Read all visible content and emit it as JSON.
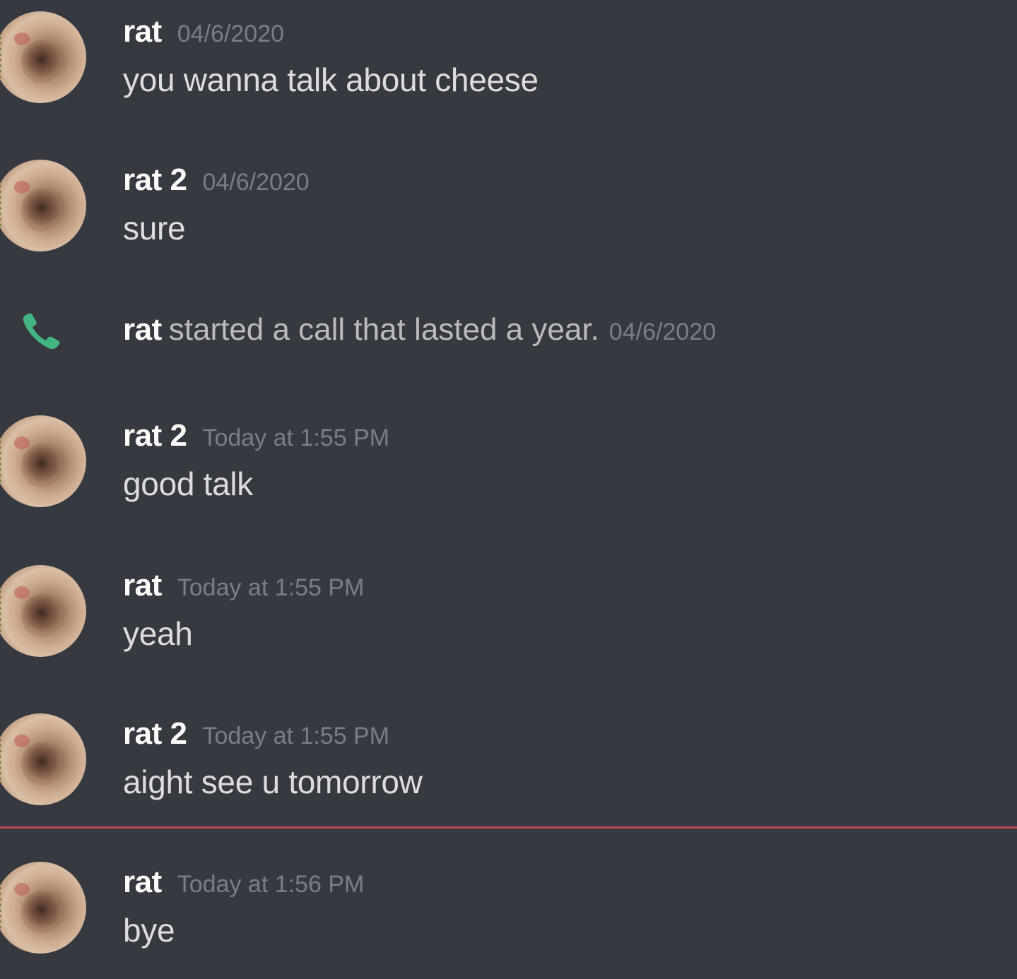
{
  "messages": [
    {
      "username": "rat",
      "timestamp": "04/6/2020",
      "text": "you wanna talk about cheese"
    },
    {
      "username": "rat 2",
      "timestamp": "04/6/2020",
      "text": "sure"
    },
    {
      "username": "rat 2",
      "timestamp": "Today at 1:55 PM",
      "text": "good talk"
    },
    {
      "username": "rat",
      "timestamp": "Today at 1:55 PM",
      "text": "yeah"
    },
    {
      "username": "rat 2",
      "timestamp": "Today at 1:55 PM",
      "text": "aight see u tomorrow"
    },
    {
      "username": "rat",
      "timestamp": "Today at 1:56 PM",
      "text": "bye"
    }
  ],
  "call_event": {
    "username": "rat",
    "text": "started a call that lasted a year.",
    "timestamp": "04/6/2020",
    "icon": "phone-icon"
  },
  "colors": {
    "background": "#363940",
    "new_messages_divider": "#b84a52",
    "call_icon": "#43b581"
  }
}
